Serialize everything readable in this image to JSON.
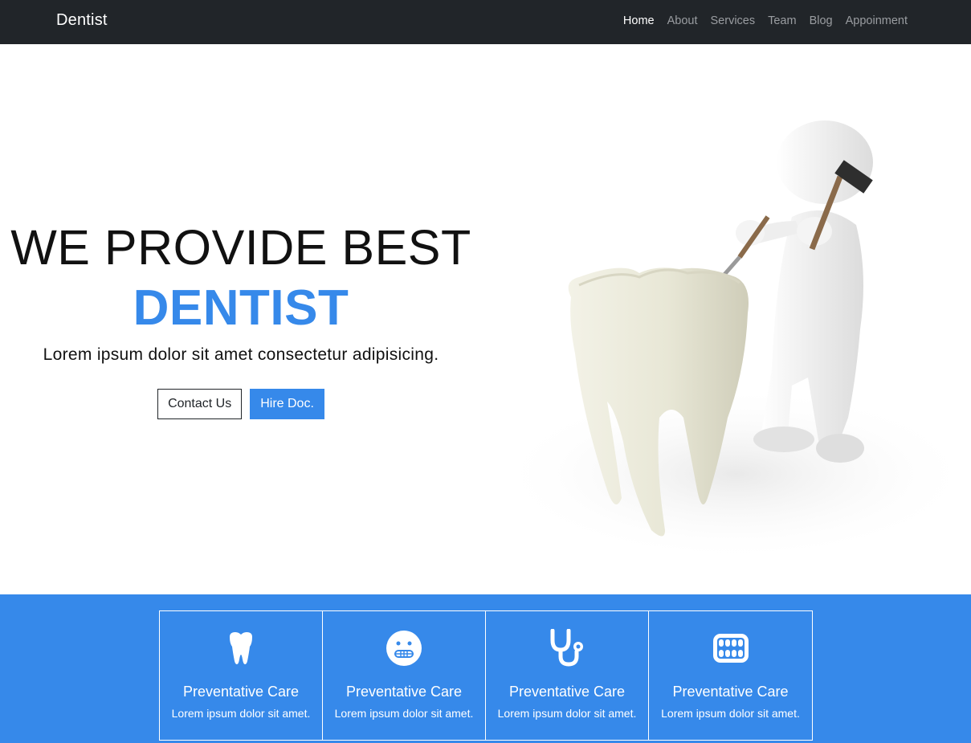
{
  "navbar": {
    "brand": "Dentist",
    "links": [
      {
        "label": "Home",
        "active": true
      },
      {
        "label": "About",
        "active": false
      },
      {
        "label": "Services",
        "active": false
      },
      {
        "label": "Team",
        "active": false
      },
      {
        "label": "Blog",
        "active": false
      },
      {
        "label": "Appoinment",
        "active": false
      }
    ]
  },
  "hero": {
    "line1": "WE PROVIDE BEST",
    "line2": "DENTIST",
    "subtitle": "Lorem ipsum dolor sit amet consectetur adipisicing.",
    "contact_label": "Contact Us",
    "hire_label": "Hire Doc.",
    "image_icon": "tooth-and-figure-with-hammer-illustration"
  },
  "services": [
    {
      "icon": "tooth-icon",
      "title": "Preventative Care",
      "desc": "Lorem ipsum dolor sit amet."
    },
    {
      "icon": "grimace-face-icon",
      "title": "Preventative Care",
      "desc": "Lorem ipsum dolor sit amet."
    },
    {
      "icon": "stethoscope-icon",
      "title": "Preventative Care",
      "desc": "Lorem ipsum dolor sit amet."
    },
    {
      "icon": "teeth-icon",
      "title": "Preventative Care",
      "desc": "Lorem ipsum dolor sit amet."
    }
  ],
  "colors": {
    "navbar_bg": "#212529",
    "accent": "#3689ea",
    "nav_inactive": "#9a9da1"
  }
}
